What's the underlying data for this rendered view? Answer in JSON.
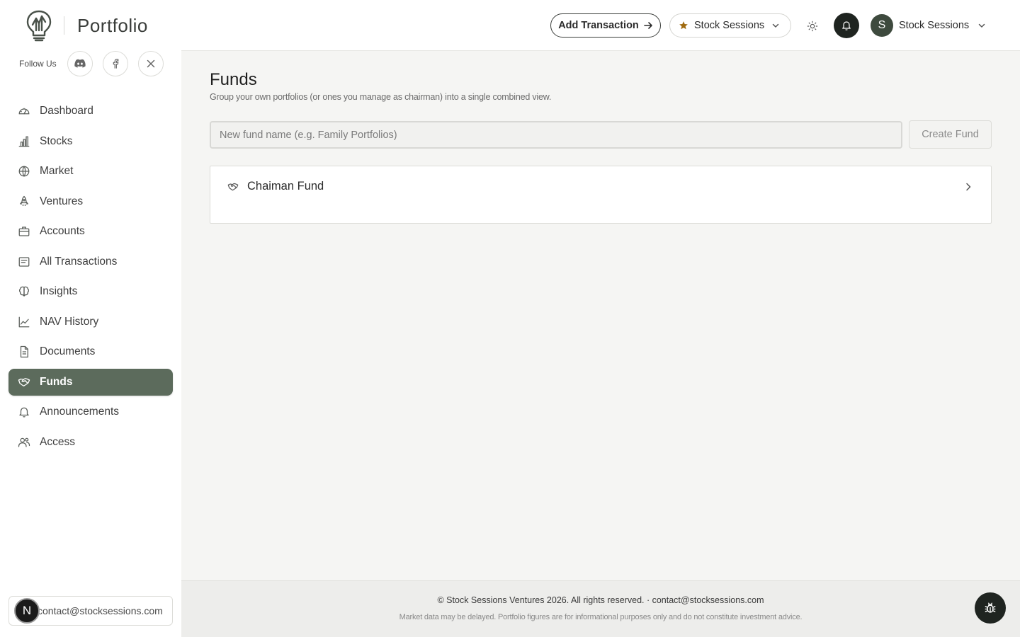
{
  "brand": {
    "title": "Portfolio",
    "logo_icon": "lightbulb-chart-logo"
  },
  "follow": {
    "label": "Follow Us",
    "socials": [
      {
        "name": "discord-icon"
      },
      {
        "name": "facebook-icon"
      },
      {
        "name": "x-icon"
      }
    ]
  },
  "sidebar": {
    "items": [
      {
        "label": "Dashboard",
        "icon": "gauge-icon"
      },
      {
        "label": "Stocks",
        "icon": "bar-chart-icon"
      },
      {
        "label": "Market",
        "icon": "globe-icon"
      },
      {
        "label": "Ventures",
        "icon": "rocket-icon"
      },
      {
        "label": "Accounts",
        "icon": "briefcase-icon"
      },
      {
        "label": "All Transactions",
        "icon": "receipt-icon"
      },
      {
        "label": "Insights",
        "icon": "brain-icon"
      },
      {
        "label": "NAV History",
        "icon": "line-chart-icon"
      },
      {
        "label": "Documents",
        "icon": "document-icon"
      },
      {
        "label": "Funds",
        "icon": "handshake-icon",
        "active": true
      },
      {
        "label": "Announcements",
        "icon": "bell-icon"
      },
      {
        "label": "Access",
        "icon": "users-icon"
      }
    ],
    "user_avatar": "N",
    "user_email": "contact@stocksessions.com"
  },
  "topbar": {
    "add_transaction_label": "Add Transaction",
    "portfolio_selector_label": "Stock Sessions",
    "profile_avatar": "S",
    "profile_name": "Stock Sessions"
  },
  "main": {
    "title": "Funds",
    "subtitle": "Group your own portfolios (or ones you manage as chairman) into a single combined view.",
    "input_placeholder": "New fund name (e.g. Family Portfolios)",
    "input_value": "",
    "create_button_label": "Create Fund",
    "funds": [
      {
        "name": "Chaiman Fund"
      }
    ]
  },
  "footer": {
    "copyright": "© Stock Sessions Ventures 2026. All rights reserved. · contact@stocksessions.com",
    "disclaimer": "Market data may be delayed. Portfolio figures are for informational purposes only and do not constitute investment advice."
  },
  "colors": {
    "accent": "#5c6b5c",
    "dark": "#1f2420",
    "star": "#a06b10",
    "main_bg": "#f5f5f3"
  }
}
